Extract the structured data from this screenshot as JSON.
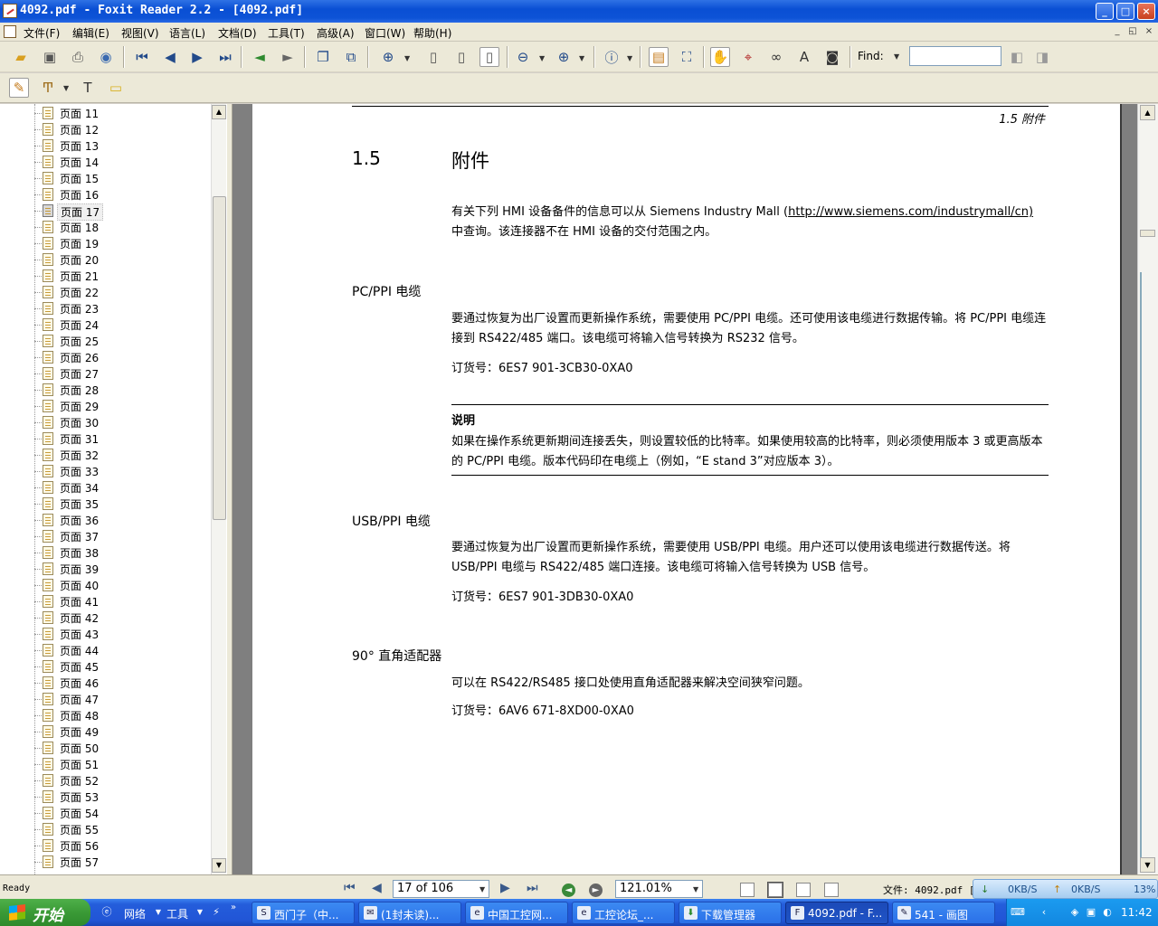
{
  "window": {
    "title": "4092.pdf - Foxit Reader 2.2 - [4092.pdf]",
    "min_label": "_",
    "max_label": "□",
    "close_label": "×",
    "mdi_controls": [
      "_",
      "◱",
      "×"
    ]
  },
  "menu": [
    {
      "label": "文件(F)"
    },
    {
      "label": "编辑(E)"
    },
    {
      "label": "视图(V)"
    },
    {
      "label": "语言(L)"
    },
    {
      "label": "文档(D)"
    },
    {
      "label": "工具(T)"
    },
    {
      "label": "高级(A)"
    },
    {
      "label": "窗口(W)"
    },
    {
      "label": "帮助(H)"
    }
  ],
  "toolbar": {
    "find_label": "Find:",
    "find_value": "",
    "icons": [
      "open-icon",
      "save-icon",
      "print-icon",
      "email-icon",
      "first-page-icon",
      "previous-page-icon",
      "next-page-icon",
      "last-page-icon",
      "back-icon",
      "forward-icon",
      "extract-page-icon",
      "rotate-icon",
      "zoom-in-icon",
      "actual-size-icon",
      "fit-page-icon",
      "fit-width-icon",
      "zoom-out-minus-icon",
      "zoom-in-plus-icon",
      "info-icon",
      "bookmarks-toggle-icon",
      "fullscreen-icon",
      "hand-tool-icon",
      "select-text-icon",
      "binoculars-icon",
      "typewriter-icon",
      "snapshot-icon"
    ],
    "annotation_icons": [
      "edit-note-icon",
      "highlighter-icon",
      "text-tool-icon",
      "comment-icon"
    ]
  },
  "sidebar": {
    "items": [
      {
        "label": "页面 11"
      },
      {
        "label": "页面 12"
      },
      {
        "label": "页面 13"
      },
      {
        "label": "页面 14"
      },
      {
        "label": "页面 15"
      },
      {
        "label": "页面 16"
      },
      {
        "label": "页面 17"
      },
      {
        "label": "页面 18"
      },
      {
        "label": "页面 19"
      },
      {
        "label": "页面 20"
      },
      {
        "label": "页面 21"
      },
      {
        "label": "页面 22"
      },
      {
        "label": "页面 23"
      },
      {
        "label": "页面 24"
      },
      {
        "label": "页面 25"
      },
      {
        "label": "页面 26"
      },
      {
        "label": "页面 27"
      },
      {
        "label": "页面 28"
      },
      {
        "label": "页面 29"
      },
      {
        "label": "页面 30"
      },
      {
        "label": "页面 31"
      },
      {
        "label": "页面 32"
      },
      {
        "label": "页面 33"
      },
      {
        "label": "页面 34"
      },
      {
        "label": "页面 35"
      },
      {
        "label": "页面 36"
      },
      {
        "label": "页面 37"
      },
      {
        "label": "页面 38"
      },
      {
        "label": "页面 39"
      },
      {
        "label": "页面 40"
      },
      {
        "label": "页面 41"
      },
      {
        "label": "页面 42"
      },
      {
        "label": "页面 43"
      },
      {
        "label": "页面 44"
      },
      {
        "label": "页面 45"
      },
      {
        "label": "页面 46"
      },
      {
        "label": "页面 47"
      },
      {
        "label": "页面 48"
      },
      {
        "label": "页面 49"
      },
      {
        "label": "页面 50"
      },
      {
        "label": "页面 51"
      },
      {
        "label": "页面 52"
      },
      {
        "label": "页面 53"
      },
      {
        "label": "页面 54"
      },
      {
        "label": "页面 55"
      },
      {
        "label": "页面 56"
      },
      {
        "label": "页面 57"
      }
    ],
    "selected_index": 6
  },
  "document": {
    "running_header": "1.5 附件",
    "section_number": "1.5",
    "section_title": "附件",
    "intro_text_1": "有关下列 HMI 设备备件的信息可以从 Siemens Industry Mall (",
    "intro_link": "http://www.siemens.com/industrymall/cn)",
    "intro_text_2": "中查询。该连接器不在 HMI 设备的交付范围之内。",
    "pcppi": {
      "heading": "PC/PPI 电缆",
      "body": "要通过恢复为出厂设置而更新操作系统，需要使用 PC/PPI 电缆。还可使用该电缆进行数据传输。将 PC/PPI 电缆连接到 RS422/485 端口。该电缆可将输入信号转换为 RS232 信号。",
      "order": "订货号：6ES7 901-3CB30-0XA0"
    },
    "note": {
      "label": "说明",
      "body": "如果在操作系统更新期间连接丢失，则设置较低的比特率。如果使用较高的比特率，则必须使用版本 3 或更高版本的 PC/PPI 电缆。版本代码印在电缆上（例如，“E stand 3”对应版本 3）。"
    },
    "usbppi": {
      "heading": "USB/PPI 电缆",
      "body": "要通过恢复为出厂设置而更新操作系统，需要使用 USB/PPI 电缆。用户还可以使用该电缆进行数据传送。将 USB/PPI 电缆与 RS422/485 端口连接。该电缆可将输入信号转换为 USB 信号。",
      "order": "订货号：6ES7 901-3DB30-0XA0"
    },
    "adapter": {
      "heading": "90° 直角适配器",
      "body": "可以在 RS422/RS485 接口处使用直角适配器来解决空间狭窄问题。",
      "order": "订货号：6AV6 671-8XD00-0XA0"
    }
  },
  "status": {
    "ready": "Ready",
    "page_indicator": "17 of 106",
    "zoom": "121.01%",
    "file_info": "文件: 4092.pdf [",
    "net_down": "0KB/S",
    "net_up": "0KB/S",
    "net_extra": "13%"
  },
  "taskbar": {
    "start_label": "开始",
    "quick_labels": [
      "网络",
      "工具"
    ],
    "tasks": [
      {
        "label": "西门子（中..."
      },
      {
        "label": "(1封未读)..."
      },
      {
        "label": "中国工控网..."
      },
      {
        "label": "工控论坛_..."
      },
      {
        "label": "下载管理器"
      },
      {
        "label": "4092.pdf - F..."
      },
      {
        "label": "541 - 画图"
      }
    ],
    "clock": "11:42"
  }
}
